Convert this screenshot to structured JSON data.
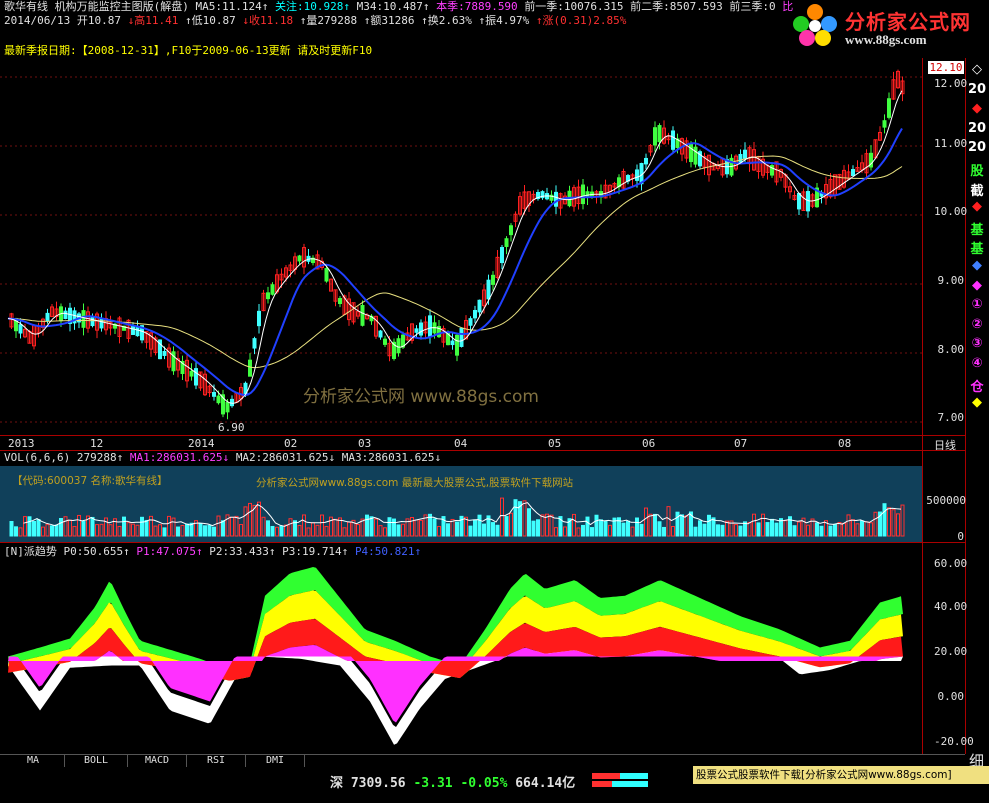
{
  "header": {
    "line1": {
      "name": "歌华有线",
      "title": "机构万能监控主图版(解盘)",
      "ma5": "MA5:11.124↑",
      "guanzhu": "关注:10.928↑",
      "m34": "M34:10.487↑",
      "benji": "本季:7889.590",
      "q1": "前一季:10076.315",
      "q2": "前二季:8507.593",
      "q3": "前三季:0",
      "more": "比"
    },
    "line2": {
      "date": "2014/06/13",
      "open": "开10.87",
      "high": "↓高11.41",
      "low": "↑低10.87",
      "close": "↓收11.18",
      "vol": "↑量279288",
      "amount": "↑额31286",
      "turnover": "↑换2.63%",
      "amplitude": "↑振4.97%",
      "change": "↑涨(0.31)2.85%"
    },
    "line3": {
      "report": "最新季报日期:【2008-12-31】",
      "f10": ",F10于2009-06-13更新 请及时更新F10"
    }
  },
  "logo": {
    "cn": "分析家公式网",
    "url": "www.88gs.com"
  },
  "main_chart": {
    "price_labels": [
      "12.00",
      "11.00",
      "10.00",
      "9.00",
      "8.00",
      "7.00"
    ],
    "current_price": "12.10",
    "low_marker": "6.90",
    "dates": [
      "2013",
      "12",
      "2014",
      "02",
      "03",
      "04",
      "05",
      "06",
      "07",
      "08"
    ],
    "period": "日线",
    "watermark": "分析家公式网 www.88gs.com"
  },
  "side_icons": [
    "◇",
    "20",
    "◆",
    "20",
    "20",
    "股",
    "截",
    "◆",
    "基",
    "基",
    "◆",
    "◆",
    "①",
    "②",
    "③",
    "④",
    "仓",
    "◆"
  ],
  "vol_panel": {
    "label": "VOL(6,6,6)",
    "val": "279288↑",
    "ma1": "MA1:286031.625↓",
    "ma2": "MA2:286031.625↓",
    "ma3": "MA3:286031.625↓",
    "code": "【代码:600037 名称:歌华有线】",
    "ad_text": "分析家公式网www.88gs.com 最新最大股票公式,股票软件下载网站",
    "axis": [
      "500000",
      "0"
    ]
  },
  "trend_panel": {
    "label": "[N]派趋势",
    "p0": "P0:50.655↑",
    "p1": "P1:47.075↑",
    "p2": "P2:33.433↑",
    "p3": "P3:19.714↑",
    "p4": "P4:50.821↑",
    "axis": [
      "60.00",
      "40.00",
      "20.00",
      "0.00",
      "-20.00"
    ]
  },
  "tabs": [
    "MA",
    "BOLL",
    "MACD",
    "RSI",
    "DMI"
  ],
  "status": {
    "market": "深",
    "index": "7309.56",
    "change": "-3.31",
    "pct": "-0.05%",
    "amount": "664.14亿",
    "ad": "股票公式股票软件下载[分析家公式网www.88gs.com]",
    "right": "细"
  }
}
